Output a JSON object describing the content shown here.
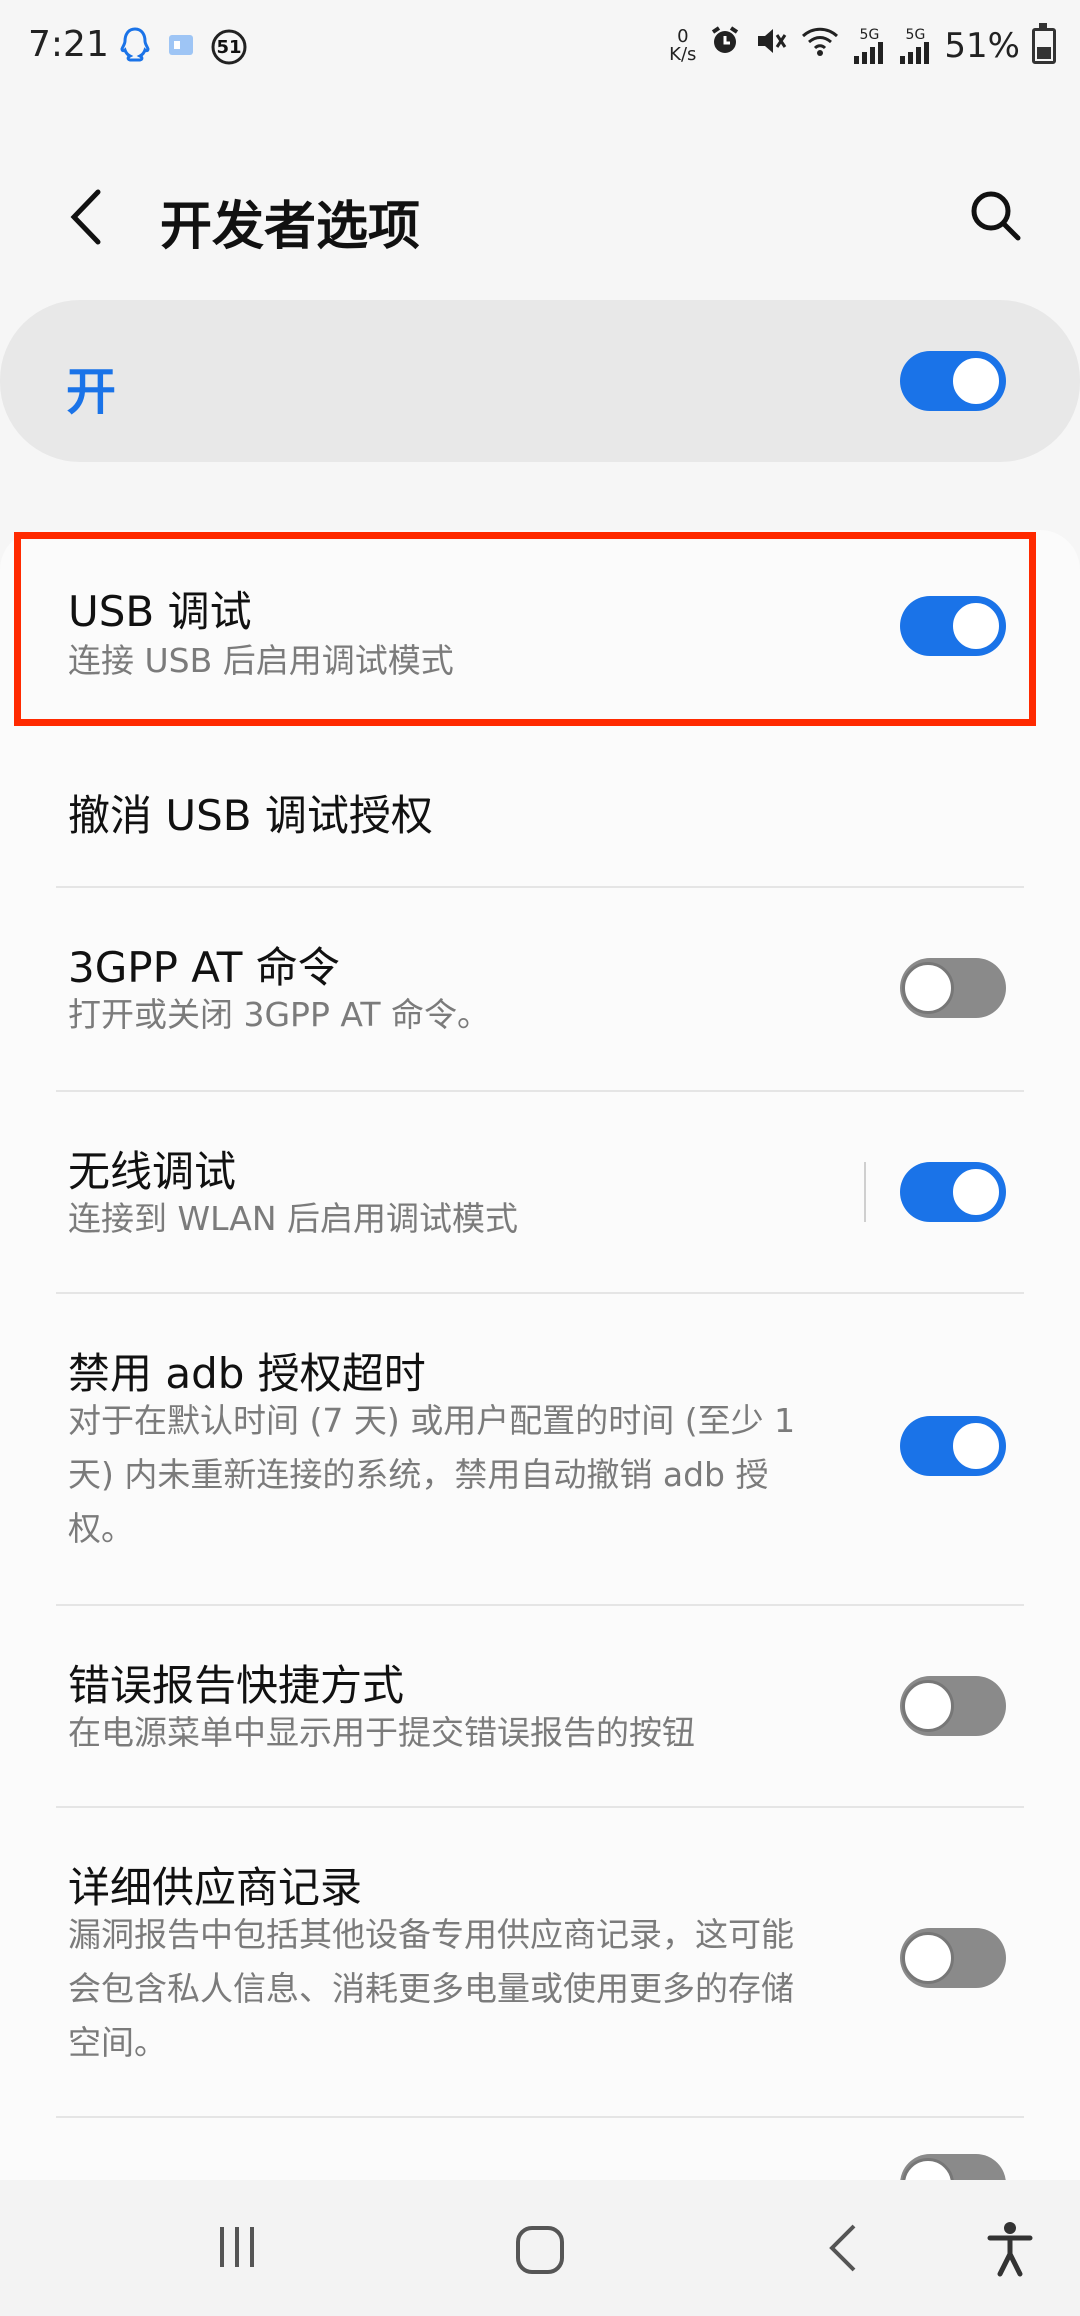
{
  "status_bar": {
    "time": "7:21",
    "net_speed_value": "0",
    "net_speed_unit": "K/s",
    "notif_count": "51",
    "sim1_label": "5G",
    "sim2_label": "5G",
    "battery": "51%"
  },
  "header": {
    "title": "开发者选项"
  },
  "master": {
    "label": "开",
    "on": true
  },
  "settings": [
    {
      "title": "USB 调试",
      "subtitle": "连接 USB 后启用调试模式",
      "toggle": "on"
    },
    {
      "title": "撤消 USB 调试授权",
      "subtitle": "",
      "toggle": "none"
    },
    {
      "title": "3GPP AT 命令",
      "subtitle": "打开或关闭 3GPP AT 命令。",
      "toggle": "off"
    },
    {
      "title": "无线调试",
      "subtitle": "连接到 WLAN 后启用调试模式",
      "toggle": "on"
    },
    {
      "title": "禁用 adb 授权超时",
      "subtitle_lines": [
        "对于在默认时间 (7 天) 或用户配置的时间 (至少 1",
        "天) 内未重新连接的系统，禁用自动撤销 adb 授",
        "权。"
      ],
      "toggle": "on"
    },
    {
      "title": "错误报告快捷方式",
      "subtitle": "在电源菜单中显示用于提交错误报告的按钮",
      "toggle": "off"
    },
    {
      "title": "详细供应商记录",
      "subtitle_lines": [
        "漏洞报告中包括其他设备专用供应商记录，这可能",
        "会包含私人信息、消耗更多电量或使用更多的存储",
        "空间。"
      ],
      "toggle": "off"
    }
  ],
  "colors": {
    "accent": "#1a73e8",
    "highlight_border": "#ff2a00"
  }
}
